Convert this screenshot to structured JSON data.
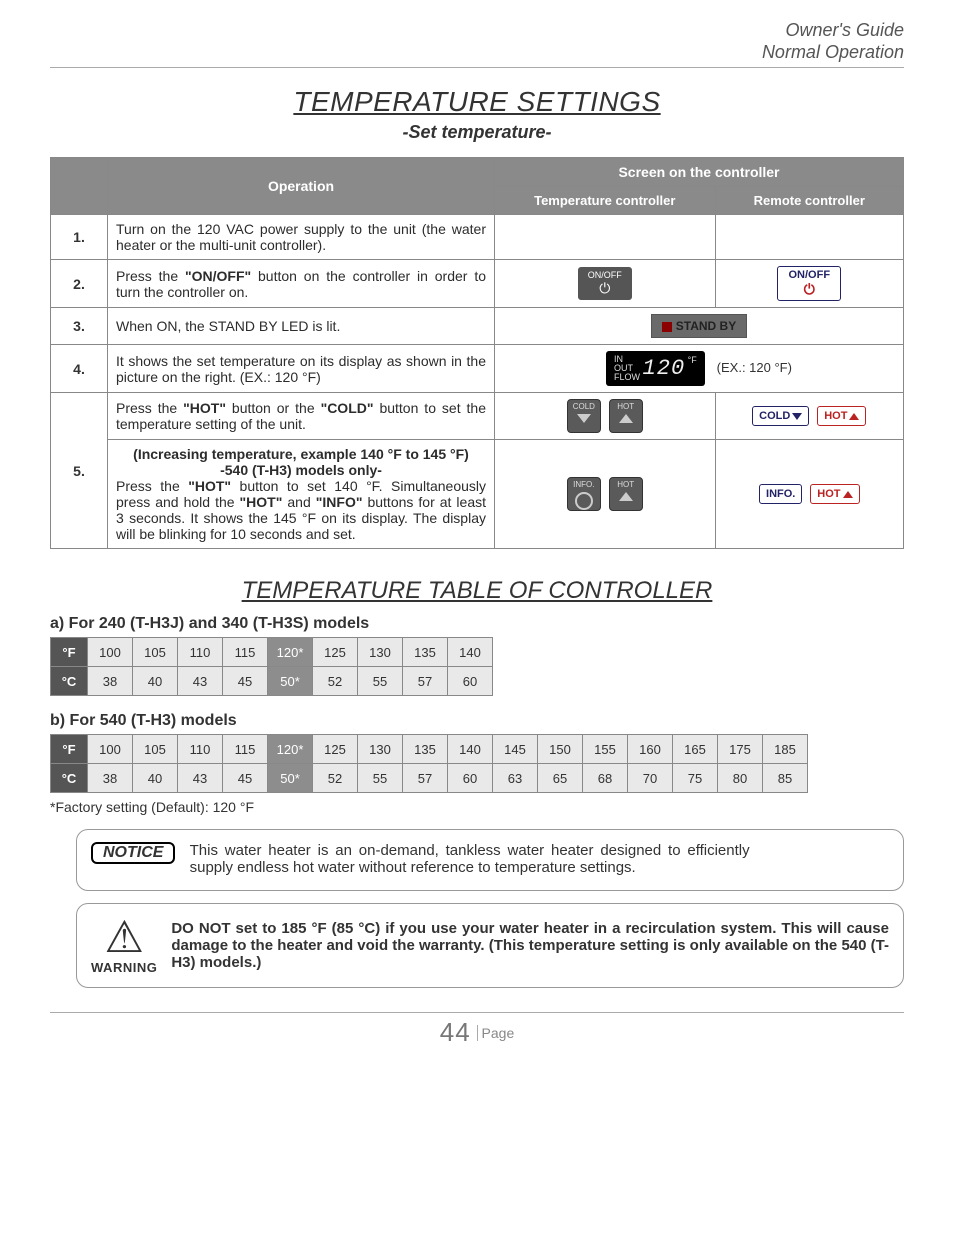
{
  "header": {
    "line1": "Owner's Guide",
    "line2": "Normal Operation"
  },
  "title": "TEMPERATURE SETTINGS",
  "subtitle": "-Set temperature-",
  "table": {
    "col_operation": "Operation",
    "col_screen": "Screen on the controller",
    "col_tc": "Temperature controller",
    "col_rc": "Remote controller"
  },
  "steps": {
    "s1": {
      "num": "1.",
      "text": "Turn on the 120 VAC power supply to the unit (the water heater or the multi-unit controller)."
    },
    "s2": {
      "num": "2.",
      "pre": "Press the ",
      "bold": "\"ON/OFF\"",
      "post": " button on the controller in order to turn the controller on.",
      "tc_label": "ON/OFF",
      "rc_label": "ON/OFF"
    },
    "s3": {
      "num": "3.",
      "text": "When ON, the STAND BY LED is lit.",
      "badge": "STAND BY"
    },
    "s4": {
      "num": "4.",
      "text": "It shows the set temperature on its display as shown in the picture on the right. (EX.: 120 °F)",
      "lcd_in": "IN",
      "lcd_out": "OUT",
      "lcd_flow": "FLOW",
      "lcd_val": "120",
      "lcd_unit": "°F",
      "ex": "(EX.: 120 °F)"
    },
    "s5a": {
      "pre": "Press the ",
      "h": "\"HOT\"",
      "mid": " button or the ",
      "c": "\"COLD\"",
      "post": " button to set the temperature setting of the unit.",
      "tc_cold": "COLD",
      "tc_hot": "HOT",
      "rc_cold": "COLD",
      "rc_hot": "HOT"
    },
    "s5": {
      "num": "5."
    },
    "s5b": {
      "l1": "(Increasing temperature, example 140 °F to 145 °F)",
      "l2": "-540 (T-H3) models only-",
      "p1": "Press the ",
      "h1": "\"HOT\"",
      "p2": " button to set 140 °F.  Simultaneously press and hold the ",
      "h2": "\"HOT\"",
      "p3": " and ",
      "i": "\"INFO\"",
      "p4": " buttons for at least 3 seconds.  It shows the 145 °F on its display.  The display will be blinking for 10 seconds and set.",
      "tc_info": "INFO.",
      "tc_hot": "HOT",
      "rc_info": "INFO.",
      "rc_hot": "HOT"
    }
  },
  "sect2": "TEMPERATURE TABLE OF CONTROLLER",
  "ta": {
    "title": "a) For 240 (T-H3J) and 340 (T-H3S) models",
    "f_label": "°F",
    "c_label": "°C",
    "f": [
      "100",
      "105",
      "110",
      "115",
      "120*",
      "125",
      "130",
      "135",
      "140"
    ],
    "c": [
      "38",
      "40",
      "43",
      "45",
      "50*",
      "52",
      "55",
      "57",
      "60"
    ]
  },
  "tb": {
    "title": "b) For 540 (T-H3) models",
    "f_label": "°F",
    "c_label": "°C",
    "f": [
      "100",
      "105",
      "110",
      "115",
      "120*",
      "125",
      "130",
      "135",
      "140",
      "145",
      "150",
      "155",
      "160",
      "165",
      "175",
      "185"
    ],
    "c": [
      "38",
      "40",
      "43",
      "45",
      "50*",
      "52",
      "55",
      "57",
      "60",
      "63",
      "65",
      "68",
      "70",
      "75",
      "80",
      "85"
    ]
  },
  "default_note": "*Factory setting (Default): 120 °F",
  "notice": {
    "label": "NOTICE",
    "text": "This water heater is an on-demand, tankless water heater designed to efficiently supply endless hot water without reference to temperature settings."
  },
  "warning": {
    "label": "WARNING",
    "text": "DO NOT set to 185 °F (85 °C) if you use your water heater in a recirculation system.  This will cause damage to the heater and void the warranty.  (This temperature setting is only available on the 540 (T-H3) models.)"
  },
  "page": {
    "num": "44",
    "label": "Page"
  }
}
